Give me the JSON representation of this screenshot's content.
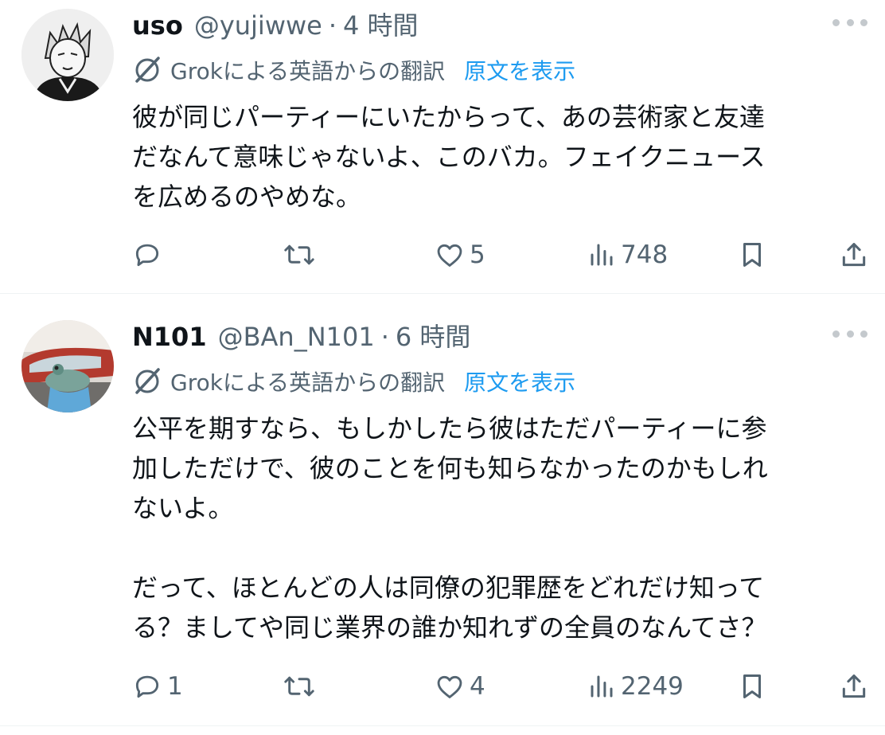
{
  "colors": {
    "text": "#0f1419",
    "secondary": "#536471",
    "accent": "#1d9bf0",
    "divider": "#eff3f4"
  },
  "tweets": [
    {
      "name": "uso",
      "handle": "@yujiwwe",
      "separator": "·",
      "time": "4 時間",
      "avatar_icon": "anime-avatar",
      "translation_label": "Grokによる英語からの翻訳",
      "show_original": "原文を表示",
      "lines": [
        "彼が同じパーティーにいたからって、あの芸術家と友達",
        "だなんて意味じゃないよ、このバカ。フェイクニュース",
        "を広めるのやめな。"
      ],
      "reply_count": "",
      "retweet_count": "",
      "like_count": "5",
      "view_count": "748"
    },
    {
      "name": "N101",
      "handle": "@BAn_N101",
      "separator": "·",
      "time": "6 時間",
      "avatar_icon": "car-avatar",
      "translation_label": "Grokによる英語からの翻訳",
      "show_original": "原文を表示",
      "lines": [
        "公平を期すなら、もしかしたら彼はただパーティーに参",
        "加しただけで、彼のことを何も知らなかったのかもしれ",
        "ないよ。",
        "",
        "だって、ほとんどの人は同僚の犯罪歴をどれだけ知って",
        "る？ましてや同じ業界の誰か知れずの全員のなんてさ？"
      ],
      "reply_count": "1",
      "retweet_count": "",
      "like_count": "4",
      "view_count": "2249"
    }
  ]
}
